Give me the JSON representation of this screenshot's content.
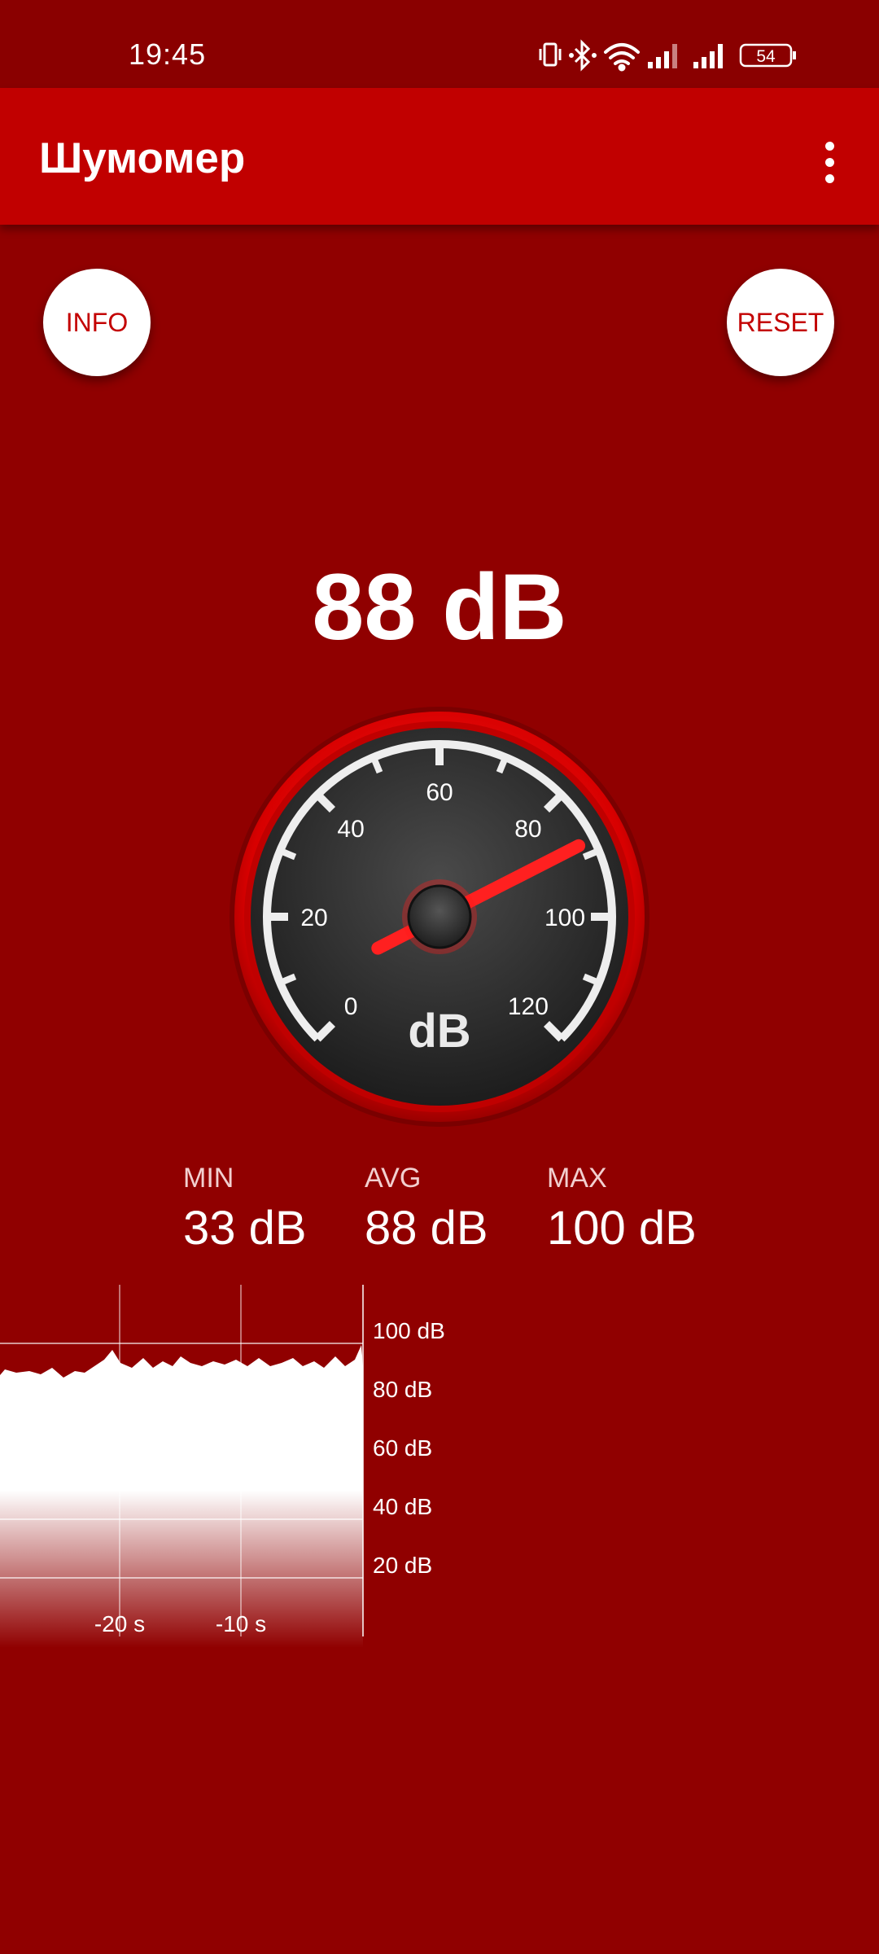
{
  "status_bar": {
    "time": "19:45",
    "battery": "54",
    "icons": [
      "vibrate-icon",
      "bluetooth-icon",
      "wifi-icon",
      "signal-icon",
      "signal-icon",
      "battery-icon"
    ]
  },
  "app_bar": {
    "title": "Шумомер",
    "menu_icon": "more-vert-icon"
  },
  "buttons": {
    "info": "INFO",
    "reset": "RESET"
  },
  "reading": {
    "current": "88 dB"
  },
  "gauge": {
    "unit": "dB",
    "min": 0,
    "max": 120,
    "ticks": [
      "0",
      "20",
      "40",
      "60",
      "80",
      "100",
      "120"
    ],
    "needle_value": 88
  },
  "stats": {
    "min_label": "MIN",
    "min_value": "33 dB",
    "avg_label": "AVG",
    "avg_value": "88 dB",
    "max_label": "MAX",
    "max_value": "100 dB"
  },
  "history": {
    "y_labels": [
      "100 dB",
      "80 dB",
      "60 dB",
      "40 dB",
      "20 dB"
    ],
    "x_labels": [
      "-20 s",
      "-10 s"
    ]
  },
  "colors": {
    "background": "#900000",
    "app_bar": "#c10000",
    "accent": "#c30000",
    "needle": "#ff2020"
  }
}
